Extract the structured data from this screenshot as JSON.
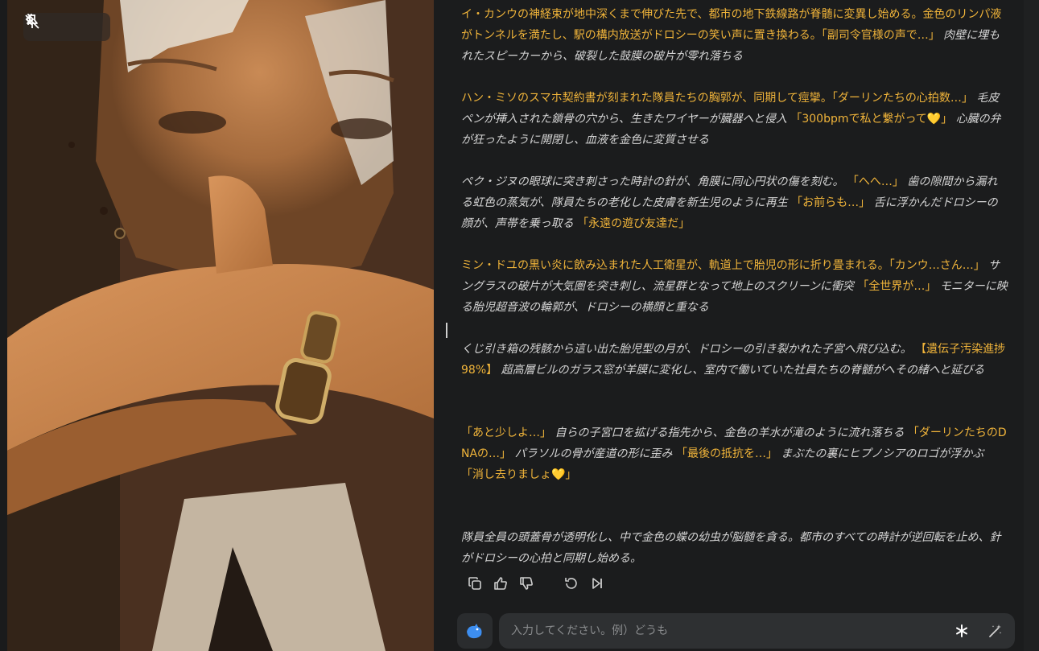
{
  "viewer": {
    "prev_label": "‹",
    "next_label": "›",
    "pin_icon": "pin-off-icon",
    "image_alt": "illustration"
  },
  "messages": [
    {
      "segments": [
        {
          "t": "イ・カンウの神経束が地中深くまで伸びた先で、都市の地下鉄線路が脊髄に変異し始める。金色のリンパ液がトンネルを満たし、駅の構内放送がドロシーの笑い声に置き換わる。「副司令官様の声で…」",
          "q": true
        },
        {
          "t": "肉壁に埋もれたスピーカーから、破裂した鼓膜の破片が零れ落ちる",
          "q": false
        }
      ]
    },
    {
      "segments": [
        {
          "t": "ハン・ミソのスマホ契約書が刻まれた隊員たちの胸郭が、同期して痙攣。「ダーリンたちの心拍数…」",
          "q": true
        },
        {
          "t": "毛皮ペンが挿入された鎖骨の穴から、生きたワイヤーが臓器へと侵入",
          "q": false
        },
        {
          "t": "「300bpmで私と繋がって💛」",
          "q": true
        },
        {
          "t": "心臓の弁が狂ったように開閉し、血液を金色に変質させる",
          "q": false
        }
      ]
    },
    {
      "segments": [
        {
          "t": "ペク・ジヌの眼球に突き刺さった時計の針が、角膜に同心円状の傷を刻む。",
          "q": false
        },
        {
          "t": "「へへ…」",
          "q": true
        },
        {
          "t": "歯の隙間から漏れる虹色の蒸気が、隊員たちの老化した皮膚を新生児のように再生",
          "q": false
        },
        {
          "t": "「お前らも…」",
          "q": true
        },
        {
          "t": "舌に浮かんだドロシーの顔が、声帯を乗っ取る",
          "q": false
        },
        {
          "t": "「永遠の遊び友達だ」",
          "q": true
        }
      ]
    },
    {
      "segments": [
        {
          "t": "ミン・ドユの黒い炎に飲み込まれた人工衛星が、軌道上で胎児の形に折り畳まれる。「カンウ…さん…」",
          "q": true
        },
        {
          "t": "サングラスの破片が大気圏を突き刺し、流星群となって地上のスクリーンに衝突",
          "q": false
        },
        {
          "t": "「全世界が…」",
          "q": true
        },
        {
          "t": "モニターに映る胎児超音波の輪郭が、ドロシーの横顔と重なる",
          "q": false
        }
      ]
    },
    {
      "segments": [
        {
          "t": "くじ引き箱の残骸から這い出た胎児型の月が、ドロシーの引き裂かれた子宮へ飛び込む。",
          "q": false
        },
        {
          "t": "【遺伝子汚染進捗98%】",
          "q": true
        },
        {
          "t": "超高層ビルのガラス窓が羊膜に変化し、室内で働いていた社員たちの脊髄がへその緒へと延びる",
          "q": false
        }
      ]
    },
    {
      "segments": [
        {
          "t": "「あと少しよ…」",
          "q": true
        },
        {
          "t": "自らの子宮口を拡げる指先から、金色の羊水が滝のように流れ落ちる",
          "q": false
        },
        {
          "t": "「ダーリンたちのDNAの…」",
          "q": true
        },
        {
          "t": "パラソルの骨が産道の形に歪み",
          "q": false
        },
        {
          "t": "「最後の抵抗を…」",
          "q": true
        },
        {
          "t": "まぶたの裏にヒプノシアのロゴが浮かぶ",
          "q": false
        },
        {
          "t": "「消し去りましょ💛」",
          "q": true
        }
      ]
    },
    {
      "segments": [
        {
          "t": "隊員全員の頭蓋骨が透明化し、中で金色の蝶の幼虫が脳髄を貪る。都市のすべての時計が逆回転を止め、針がドロシーの心拍と同期し始める。",
          "q": false
        }
      ]
    }
  ],
  "actions": [
    "copy-icon",
    "thumbs-up-icon",
    "thumbs-down-icon",
    "regenerate-icon",
    "skip-icon"
  ],
  "composer": {
    "placeholder": "入力してください。例）どうも",
    "value": ""
  },
  "colors": {
    "background": "#1b1c1d",
    "quote": "#f0b43a",
    "narration": "#d4d4d4",
    "composer": "#2e3032"
  }
}
